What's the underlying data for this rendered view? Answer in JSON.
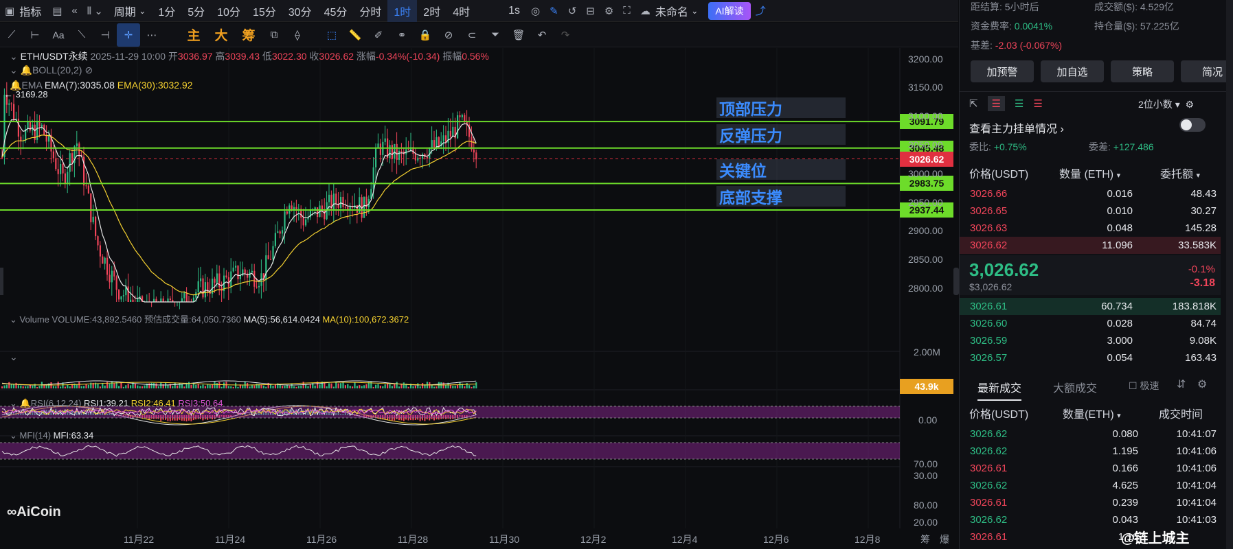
{
  "toolbar": {
    "indicators": "指标",
    "period": "周期",
    "timeframes": [
      "1分",
      "5分",
      "10分",
      "15分",
      "30分",
      "45分",
      "分时",
      "1时",
      "2时",
      "4时"
    ],
    "active_timeframe": "1时",
    "second": "1s",
    "layout_name": "未命名",
    "ai_label": "AI解读"
  },
  "draw_toolbar": {
    "main": "主",
    "big": "大",
    "chips": "筹"
  },
  "chart_info": {
    "symbol": "ETH/USDT永续",
    "datetime": "2025-11-29 10:00",
    "open_label": "开",
    "open": "3036.97",
    "high_label": "高",
    "high": "3039.43",
    "low_label": "低",
    "low": "3022.30",
    "close_label": "收",
    "close": "3026.62",
    "change_label": "涨幅",
    "change": "-0.34%(-10.34)",
    "amp_label": "振幅",
    "amp": "0.56%",
    "boll": "BOLL(20,2)",
    "ema": "EMA",
    "ema7": "EMA(7):3035.08",
    "ema30": "EMA(30):3032.92",
    "high_mark": "← 3169.28",
    "volume_name": "Volume",
    "volume_val": "VOLUME:43,892.5460",
    "volume_est": "预估成交量:64,050.7360",
    "vol_ma5": "MA(5):56,614.0424",
    "vol_ma10": "MA(10):100,672.3672",
    "rsi_name": "RSI(6,12,24)",
    "rsi1": "RSI1:39.21",
    "rsi2": "RSI2:46.41",
    "rsi3": "RSI3:50.64",
    "mfi_name": "MFI(14)",
    "mfi_val": "MFI:63.34",
    "watermark": "AiCoin"
  },
  "levels": [
    {
      "label": "顶部压力",
      "price": "3091.79"
    },
    {
      "label": "反弹压力",
      "price": "3045.48"
    },
    {
      "label": "关键位",
      "price": "2983.75"
    },
    {
      "label": "底部支撑",
      "price": "2937.44"
    }
  ],
  "current_price_tag": "3026.62",
  "volume_tag": "43.9k",
  "price_axis": [
    "3200.00",
    "3150.00",
    "3100.00",
    "3050.00",
    "3000.00",
    "2950.00",
    "2900.00",
    "2850.00",
    "2800.00"
  ],
  "volume_axis": [
    "2.00M"
  ],
  "macd_axis": [
    "0.00"
  ],
  "rsi_axis": [
    "70.00",
    "30.00"
  ],
  "mfi_axis": [
    "80.00",
    "20.00"
  ],
  "date_axis": [
    "11月22",
    "11月24",
    "11月26",
    "11月28",
    "11月30",
    "12月2",
    "12月4",
    "12月6",
    "12月8"
  ],
  "corner_labels": [
    "筹",
    "爆"
  ],
  "right_panel": {
    "settle_label": "距结算:",
    "settle_val": "5小时后",
    "turnover_label": "成交额($):",
    "turnover_val": "4.529亿",
    "funding_label": "资金费率:",
    "funding_val": "0.0041%",
    "oi_label": "持仓量($):",
    "oi_val": "57.225亿",
    "basis_label": "基差:",
    "basis_val": "-2.03 (-0.067%)",
    "buttons": [
      "加预警",
      "加自选",
      "策略",
      "简况"
    ],
    "decimals": "2位小数",
    "main_orders": "查看主力挂单情况",
    "ratio_label": "委比:",
    "ratio_val": "+0.75%",
    "diff_label": "委差:",
    "diff_val": "+127.486",
    "ob_headers": [
      "价格(USDT)",
      "数量 (ETH)",
      "委托额"
    ],
    "asks": [
      [
        "3026.66",
        "0.016",
        "48.43"
      ],
      [
        "3026.65",
        "0.010",
        "30.27"
      ],
      [
        "3026.63",
        "0.048",
        "145.28"
      ],
      [
        "3026.62",
        "11.096",
        "33.583K"
      ]
    ],
    "last_price": "3,026.62",
    "last_usd": "$3,026.62",
    "last_pct": "-0.1%",
    "last_chg": "-3.18",
    "bids": [
      [
        "3026.61",
        "60.734",
        "183.818K"
      ],
      [
        "3026.60",
        "0.028",
        "84.74"
      ],
      [
        "3026.59",
        "3.000",
        "9.08K"
      ],
      [
        "3026.57",
        "0.054",
        "163.43"
      ]
    ],
    "trade_tabs": [
      "最新成交",
      "大额成交"
    ],
    "fast_label": "极速",
    "trade_headers": [
      "价格(USDT)",
      "数量(ETH)",
      "成交时间"
    ],
    "trades": [
      [
        "3026.62",
        "0.080",
        "10:41:07",
        "buy"
      ],
      [
        "3026.62",
        "1.195",
        "10:41:06",
        "buy"
      ],
      [
        "3026.61",
        "0.166",
        "10:41:06",
        "sell"
      ],
      [
        "3026.62",
        "4.625",
        "10:41:04",
        "buy"
      ],
      [
        "3026.61",
        "0.239",
        "10:41:04",
        "sell"
      ],
      [
        "3026.62",
        "0.043",
        "10:41:03",
        "buy"
      ],
      [
        "3026.61",
        "1.16",
        "",
        "sell"
      ]
    ],
    "watermark": "@链上城主"
  },
  "colors": {
    "up": "#2ebd85",
    "down": "#f0455a",
    "level": "#6ddc2a",
    "ema7": "#e8e8e8",
    "ema30": "#f5d130",
    "accent": "#3b82f6"
  }
}
